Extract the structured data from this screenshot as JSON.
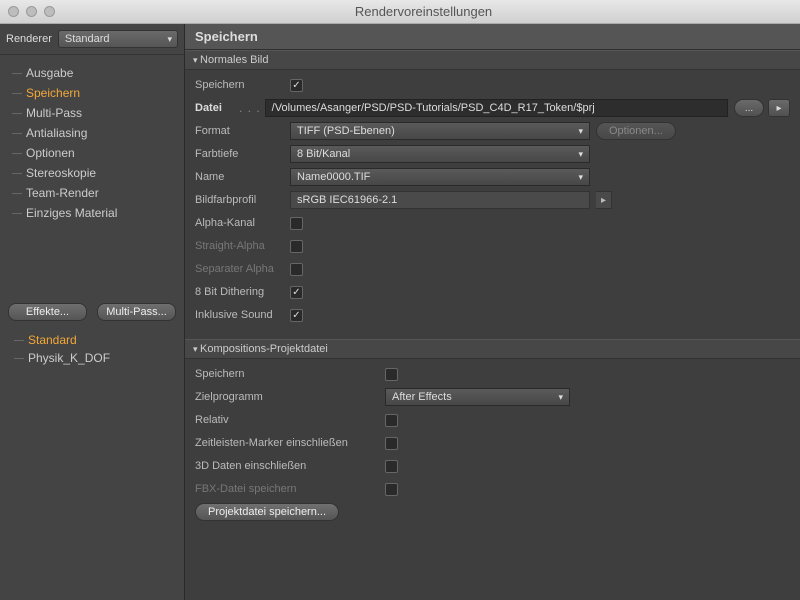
{
  "window": {
    "title": "Rendervoreinstellungen"
  },
  "sidebar": {
    "renderer_label": "Renderer",
    "renderer_value": "Standard",
    "items": [
      {
        "label": "Ausgabe",
        "active": false
      },
      {
        "label": "Speichern",
        "active": true
      },
      {
        "label": "Multi-Pass",
        "active": false
      },
      {
        "label": "Antialiasing",
        "active": false
      },
      {
        "label": "Optionen",
        "active": false
      },
      {
        "label": "Stereoskopie",
        "active": false
      },
      {
        "label": "Team-Render",
        "active": false
      },
      {
        "label": "Einziges Material",
        "active": false
      }
    ],
    "btn_effects": "Effekte...",
    "btn_multipass": "Multi-Pass...",
    "presets": [
      {
        "label": "Standard",
        "active": true
      },
      {
        "label": "Physik_K_DOF",
        "active": false
      }
    ]
  },
  "main": {
    "header": "Speichern",
    "section1": {
      "title": "Normales Bild",
      "save_label": "Speichern",
      "save_checked": true,
      "file_label": "Datei",
      "file_value": "/Volumes/Asanger/PSD/PSD-Tutorials/PSD_C4D_R17_Token/$prj",
      "browse": "...",
      "format_label": "Format",
      "format_value": "TIFF (PSD-Ebenen)",
      "options_btn": "Optionen...",
      "depth_label": "Farbtiefe",
      "depth_value": "8 Bit/Kanal",
      "name_label": "Name",
      "name_value": "Name0000.TIF",
      "profile_label": "Bildfarbprofil",
      "profile_value": "sRGB IEC61966-2.1",
      "alpha_label": "Alpha-Kanal",
      "straight_label": "Straight-Alpha",
      "sepalpha_label": "Separater Alpha",
      "dither_label": "8 Bit Dithering",
      "sound_label": "Inklusive Sound"
    },
    "section2": {
      "title": "Kompositions-Projektdatei",
      "save_label": "Speichern",
      "target_label": "Zielprogramm",
      "target_value": "After Effects",
      "relative_label": "Relativ",
      "marker_label": "Zeitleisten-Marker einschließen",
      "d3_label": "3D Daten einschließen",
      "fbx_label": "FBX-Datei speichern",
      "proj_btn": "Projektdatei speichern..."
    }
  }
}
